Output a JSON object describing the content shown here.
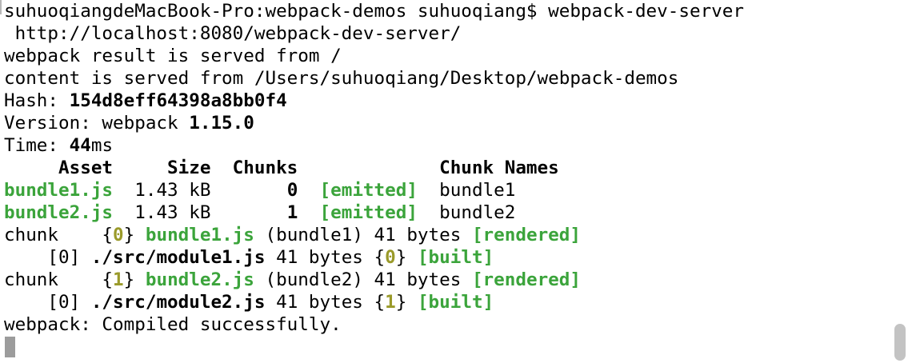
{
  "terminal": {
    "lines": [
      {
        "segments": [
          {
            "text": "suhuoqiangdeMacBook-Pro:webpack-demos suhuoqiang$ webpack-dev-server",
            "style": "n"
          }
        ]
      },
      {
        "segments": [
          {
            "text": " http://localhost:8080/webpack-dev-server/",
            "style": "n"
          }
        ]
      },
      {
        "segments": [
          {
            "text": "webpack result is served from /",
            "style": "n"
          }
        ]
      },
      {
        "segments": [
          {
            "text": "content is served from /Users/suhuoqiang/Desktop/webpack-demos",
            "style": "n"
          }
        ]
      },
      {
        "segments": [
          {
            "text": "Hash: ",
            "style": "n"
          },
          {
            "text": "154d8eff64398a8bb0f4",
            "style": "b"
          }
        ]
      },
      {
        "segments": [
          {
            "text": "Version: webpack ",
            "style": "n"
          },
          {
            "text": "1.15.0",
            "style": "b"
          }
        ]
      },
      {
        "segments": [
          {
            "text": "Time: ",
            "style": "n"
          },
          {
            "text": "44",
            "style": "b"
          },
          {
            "text": "ms",
            "style": "n"
          }
        ]
      },
      {
        "segments": [
          {
            "text": "     Asset     Size  Chunks             Chunk Names",
            "style": "b"
          }
        ]
      },
      {
        "segments": [
          {
            "text": "bundle1.js",
            "style": "g"
          },
          {
            "text": "  1.43 kB       ",
            "style": "n"
          },
          {
            "text": "0",
            "style": "b"
          },
          {
            "text": "  ",
            "style": "n"
          },
          {
            "text": "[emitted]",
            "style": "g"
          },
          {
            "text": "  bundle1",
            "style": "n"
          }
        ]
      },
      {
        "segments": [
          {
            "text": "bundle2.js",
            "style": "g"
          },
          {
            "text": "  1.43 kB       ",
            "style": "n"
          },
          {
            "text": "1",
            "style": "b"
          },
          {
            "text": "  ",
            "style": "n"
          },
          {
            "text": "[emitted]",
            "style": "g"
          },
          {
            "text": "  bundle2",
            "style": "n"
          }
        ]
      },
      {
        "segments": [
          {
            "text": "chunk    {",
            "style": "n"
          },
          {
            "text": "0",
            "style": "y"
          },
          {
            "text": "} ",
            "style": "n"
          },
          {
            "text": "bundle1.js",
            "style": "g"
          },
          {
            "text": " (bundle1) 41 bytes ",
            "style": "n"
          },
          {
            "text": "[rendered]",
            "style": "g"
          }
        ]
      },
      {
        "segments": [
          {
            "text": "    [0] ",
            "style": "n"
          },
          {
            "text": "./src/module1.js",
            "style": "b"
          },
          {
            "text": " 41 bytes {",
            "style": "n"
          },
          {
            "text": "0",
            "style": "y"
          },
          {
            "text": "} ",
            "style": "n"
          },
          {
            "text": "[built]",
            "style": "g"
          }
        ]
      },
      {
        "segments": [
          {
            "text": "chunk    {",
            "style": "n"
          },
          {
            "text": "1",
            "style": "y"
          },
          {
            "text": "} ",
            "style": "n"
          },
          {
            "text": "bundle2.js",
            "style": "g"
          },
          {
            "text": " (bundle2) 41 bytes ",
            "style": "n"
          },
          {
            "text": "[rendered]",
            "style": "g"
          }
        ]
      },
      {
        "segments": [
          {
            "text": "    [0] ",
            "style": "n"
          },
          {
            "text": "./src/module2.js",
            "style": "b"
          },
          {
            "text": " 41 bytes {",
            "style": "n"
          },
          {
            "text": "1",
            "style": "y"
          },
          {
            "text": "} ",
            "style": "n"
          },
          {
            "text": "[built]",
            "style": "g"
          }
        ]
      },
      {
        "segments": [
          {
            "text": "webpack: Compiled successfully.",
            "style": "n"
          }
        ]
      }
    ]
  },
  "colors": {
    "background": "#ffffff",
    "text": "#000000",
    "success_green": "#3ba43b",
    "chunk_id_yellow": "#9a9a2a",
    "cursor": "#9c9c9c",
    "scrollbar": "#c3c3c3"
  }
}
